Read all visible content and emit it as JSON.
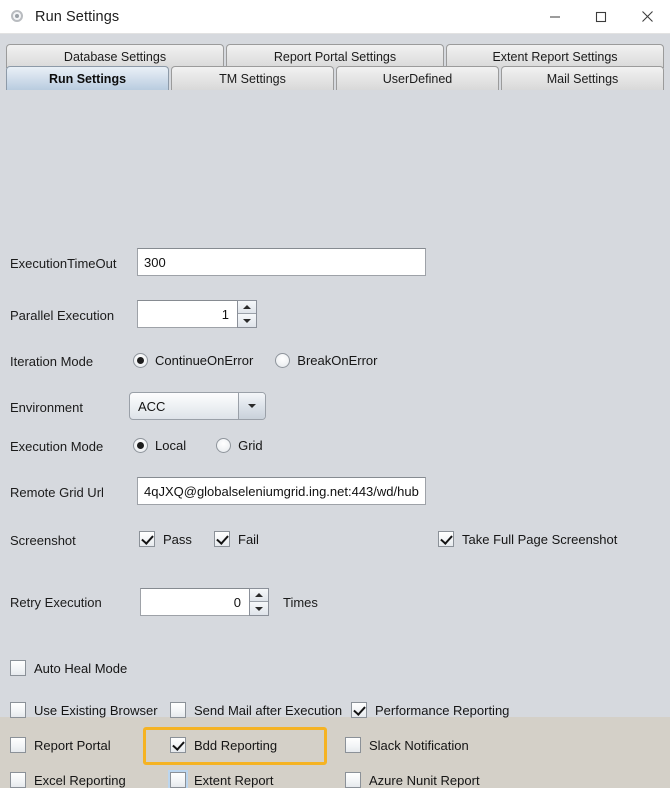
{
  "window": {
    "title": "Run Settings",
    "icon": "app-settings-icon",
    "controls": {
      "minimize": "minimize-icon",
      "maximize": "maximize-icon",
      "close": "close-icon"
    }
  },
  "tabs": {
    "row1": [
      {
        "label": "Database Settings",
        "active": false
      },
      {
        "label": "Report Portal Settings",
        "active": false
      },
      {
        "label": "Extent Report Settings",
        "active": false
      }
    ],
    "row2": [
      {
        "label": "Run Settings",
        "active": true
      },
      {
        "label": "TM Settings",
        "active": false
      },
      {
        "label": "UserDefined",
        "active": false
      },
      {
        "label": "Mail Settings",
        "active": false
      }
    ]
  },
  "form": {
    "execution_timeout": {
      "label": "ExecutionTimeOut",
      "value": "300"
    },
    "parallel_execution": {
      "label": "Parallel Execution",
      "value": "1"
    },
    "iteration_mode": {
      "label": "Iteration Mode",
      "options": [
        {
          "label": "ContinueOnError",
          "selected": true
        },
        {
          "label": "BreakOnError",
          "selected": false
        }
      ]
    },
    "environment": {
      "label": "Environment",
      "value": "ACC"
    },
    "execution_mode": {
      "label": "Execution Mode",
      "options": [
        {
          "label": "Local",
          "selected": true
        },
        {
          "label": "Grid",
          "selected": false
        }
      ]
    },
    "remote_grid_url": {
      "label": "Remote Grid Url",
      "value": "4qJXQ@globalseleniumgrid.ing.net:443/wd/hub"
    },
    "screenshot": {
      "label": "Screenshot",
      "pass": {
        "label": "Pass",
        "checked": true
      },
      "fail": {
        "label": "Fail",
        "checked": true
      },
      "full_page": {
        "label": "Take Full Page Screenshot",
        "checked": true
      }
    },
    "retry_execution": {
      "label": "Retry Execution",
      "value": "0",
      "suffix": "Times"
    }
  },
  "options": {
    "auto_heal_mode": {
      "label": "Auto Heal Mode",
      "checked": false
    },
    "use_existing_browser": {
      "label": "Use Existing Browser",
      "checked": false
    },
    "send_mail_after_execution": {
      "label": "Send Mail after Execution",
      "checked": false
    },
    "performance_reporting": {
      "label": "Performance Reporting",
      "checked": true
    },
    "report_portal": {
      "label": "Report Portal",
      "checked": false
    },
    "bdd_reporting": {
      "label": "Bdd Reporting",
      "checked": true,
      "highlighted": true
    },
    "slack_notification": {
      "label": "Slack Notification",
      "checked": false
    },
    "excel_reporting": {
      "label": "Excel Reporting",
      "checked": false
    },
    "extent_report": {
      "label": "Extent Report",
      "checked": false,
      "focused": true
    },
    "azure_nunit_report": {
      "label": "Azure Nunit Report",
      "checked": false
    }
  },
  "colors": {
    "highlight": "#f5b323",
    "window_bg": "#d6d9de",
    "active_tab": "#b9ccdf"
  }
}
